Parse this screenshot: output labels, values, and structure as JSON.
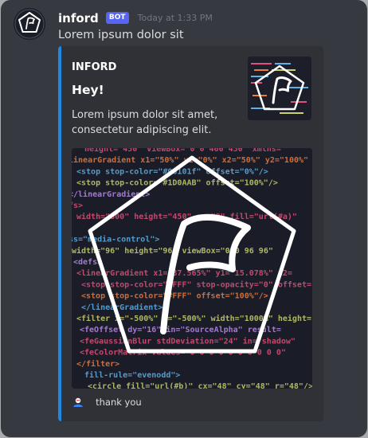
{
  "message": {
    "username": "inford",
    "bot_tag": "BOT",
    "timestamp": "Today at 1:33 PM",
    "content": "Lorem ipsum dolor sit"
  },
  "embed": {
    "accent_color": "#1e88e5",
    "author": "INFORD",
    "title": "Hey!",
    "description": "Lorem ipsum dolor sit amet, consectetur adipiscing elit.",
    "footer_text": "thank you"
  },
  "code_lines": [
    "height=\"450\" viewBox=\"0 0 460 450\" xmlns=",
    "linearGradient x1=\"50%\" y1=\"0%\" x2=\"50%\" y2=\"100%\" id=",
    "<stop stop-color=\"#06101f\" offset=\"0%\"/>",
    "<stop stop-color=\"#1D0AAB\" offset=\"100%\"/>",
    "</linearGradient>",
    "fs>",
    "width=\"800\" height=\"450\" rx=\"8\" fill=\"url(#a)\"",
    "",
    "ss=\"media-control\">",
    "width=\"96\" height=\"96\" viewBox=\"0 0 96 96\"",
    "<defs>",
    "<linearGradient x1=\"87.565%\" y1=\"15.078%\" x2=",
    "<stop stop-color=\"#FFF\" stop-opacity=\"0\" offset=",
    "<stop stop-color=\"#FFF\" offset=\"100%\"/>",
    "</linearGradient>",
    "<filter x=\"-500%\" y=\"-500%\" width=\"1000%\" height=",
    "<feOffset dy=\"16\" in=\"SourceAlpha\" result=",
    "<feGaussianBlur stdDeviation=\"24\" in=\"shadow\"",
    "<feColorMatrix values=\"0 0 0 0 0 0 0 0 0 0\"",
    "</filter>",
    "fill-rule=\"evenodd\">",
    "<circle fill=\"url(#b)\" cx=\"48\" cy=\"48\" r=\"48\"/>"
  ]
}
